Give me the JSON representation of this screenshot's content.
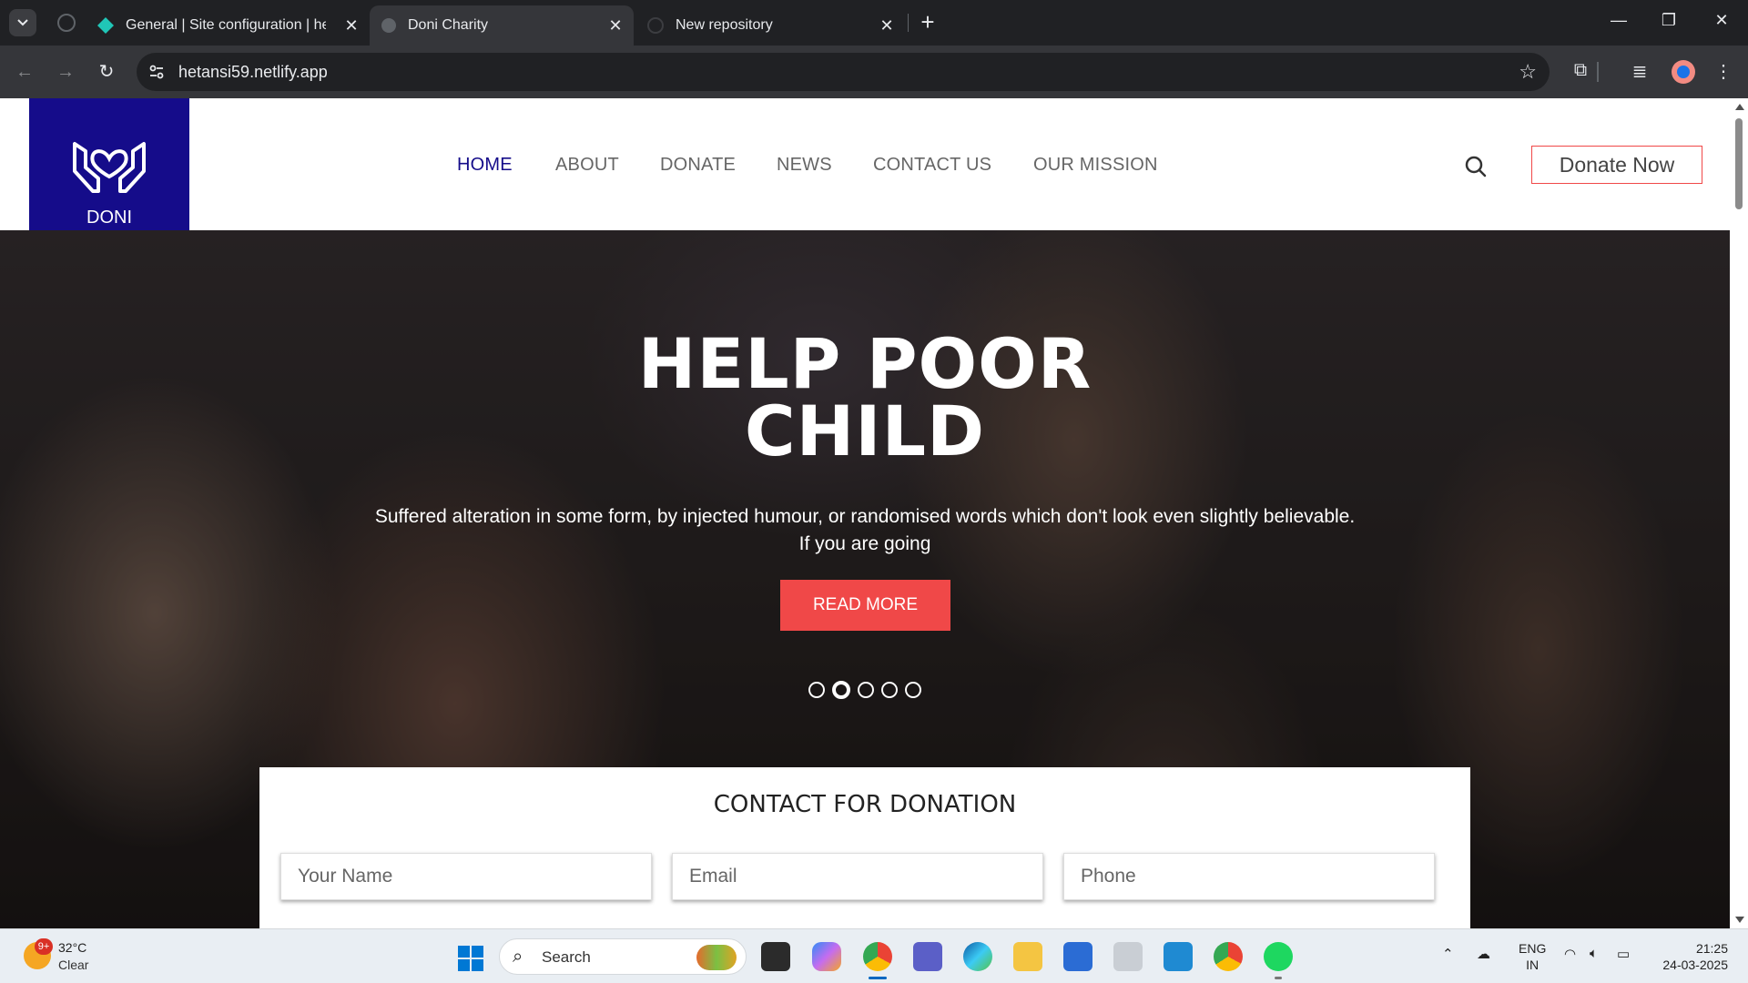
{
  "browser": {
    "tabs": [
      {
        "title": "General | Site configuration | hetansi59"
      },
      {
        "title": "Doni Charity"
      },
      {
        "title": "New repository"
      }
    ],
    "url": "hetansi59.netlify.app"
  },
  "site": {
    "logo_text": "DONI",
    "nav": [
      "HOME",
      "ABOUT",
      "DONATE",
      "NEWS",
      "CONTACT US",
      "OUR MISSION"
    ],
    "donate_button": "Donate Now",
    "hero": {
      "title_line1": "HELP POOR",
      "title_line2": "CHILD",
      "text_line1": "Suffered alteration in some form, by injected humour, or randomised words which don't look even slightly believable.",
      "text_line2": "If you are going",
      "button": "READ MORE",
      "slides": 5,
      "active_slide": 2
    },
    "form": {
      "title": "CONTACT FOR DONATION",
      "name_placeholder": "Your Name",
      "email_placeholder": "Email",
      "phone_placeholder": "Phone"
    }
  },
  "taskbar": {
    "weather_badge": "9+",
    "temperature": "32°C",
    "condition": "Clear",
    "search_label": "Search",
    "lang_line1": "ENG",
    "lang_line2": "IN",
    "time": "21:25",
    "date": "24-03-2025"
  },
  "colors": {
    "brand_navy": "#150c8a",
    "accent_red": "#f04848"
  }
}
